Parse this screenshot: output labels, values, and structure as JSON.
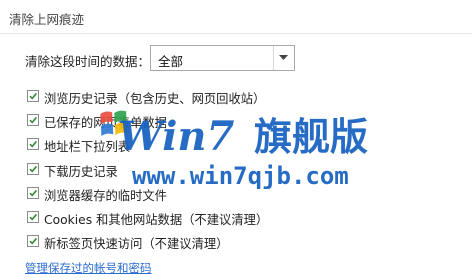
{
  "dialog": {
    "title": "清除上网痕迹",
    "range_label": "清除这段时间的数据：",
    "range_value": "全部"
  },
  "options": [
    {
      "label": "浏览历史记录（包含历史、网页回收站）",
      "checked": true
    },
    {
      "label": "已保存的网页表单数据",
      "checked": true
    },
    {
      "label": "地址栏下拉列表",
      "checked": true
    },
    {
      "label": "下载历史记录",
      "checked": true
    },
    {
      "label": "浏览器缓存的临时文件",
      "checked": true
    },
    {
      "label": "Cookies 和其他网站数据（不建议清理）",
      "checked": true
    },
    {
      "label": "新标签页快速访问（不建议清理）",
      "checked": true
    }
  ],
  "manage_link": "管理保存过的帐号和密码",
  "watermark": {
    "logo": "Win7",
    "brand": "旗舰版",
    "url": "www.win7qjb.com"
  },
  "colors": {
    "checkbox_check": "#3e8b3e",
    "link": "#2a6bd1",
    "watermark_blue": "#1560c0"
  }
}
